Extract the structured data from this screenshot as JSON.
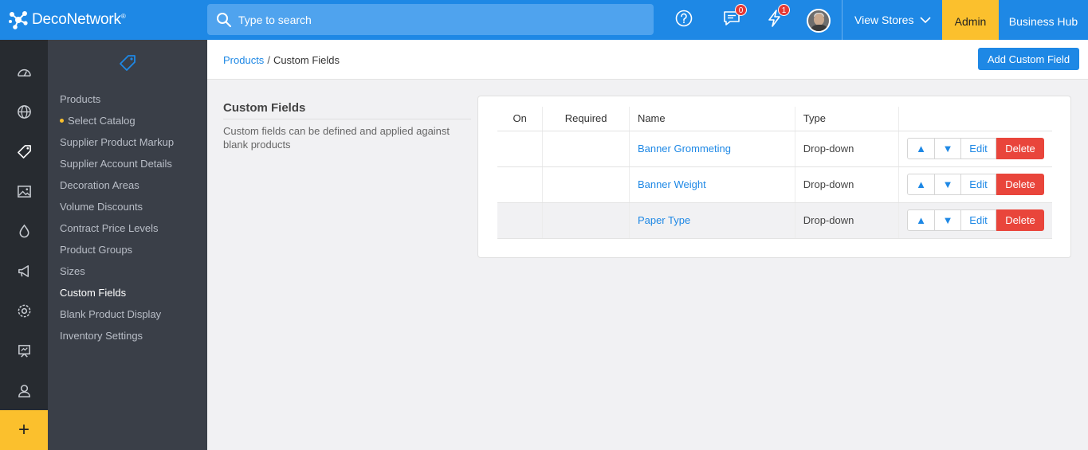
{
  "topbar": {
    "brand": "DecoNetwork",
    "brand_mark": "®",
    "search_placeholder": "Type to search",
    "messages_count": "0",
    "notifications_count": "1",
    "view_stores_label": "View Stores",
    "admin_label": "Admin",
    "business_hub_label": "Business Hub"
  },
  "rail": {
    "items": [
      "dashboard-icon",
      "globe-icon",
      "tag-icon",
      "image-icon",
      "drop-icon",
      "megaphone-icon",
      "settings-icon",
      "presentation-icon",
      "user-icon"
    ],
    "add_label": "+"
  },
  "subnav": {
    "icon": "tag-icon",
    "items": [
      {
        "label": "Products"
      },
      {
        "label": "Select Catalog"
      },
      {
        "label": "Supplier Product Markup"
      },
      {
        "label": "Supplier Account Details"
      },
      {
        "label": "Decoration Areas"
      },
      {
        "label": "Volume Discounts"
      },
      {
        "label": "Contract Price Levels"
      },
      {
        "label": "Product Groups"
      },
      {
        "label": "Sizes"
      },
      {
        "label": "Custom Fields"
      },
      {
        "label": "Blank Product Display"
      },
      {
        "label": "Inventory Settings"
      }
    ]
  },
  "breadcrumb": {
    "parent": "Products",
    "separator": "/",
    "current": "Custom Fields"
  },
  "add_button_label": "Add Custom Field",
  "section": {
    "title": "Custom Fields",
    "description": "Custom fields can be defined and applied against blank products"
  },
  "table": {
    "headers": {
      "on": "On",
      "required": "Required",
      "name": "Name",
      "type": "Type"
    },
    "rows": [
      {
        "name": "Banner Grommeting",
        "type": "Drop-down"
      },
      {
        "name": "Banner Weight",
        "type": "Drop-down"
      },
      {
        "name": "Paper Type",
        "type": "Drop-down"
      }
    ],
    "actions": {
      "up": "▲",
      "down": "▼",
      "edit": "Edit",
      "delete": "Delete"
    }
  },
  "colors": {
    "primary": "#1e88e5",
    "accent": "#fbc02d",
    "danger": "#e9453b",
    "rail_bg": "#272b30",
    "subnav_bg": "#3a3f48"
  }
}
